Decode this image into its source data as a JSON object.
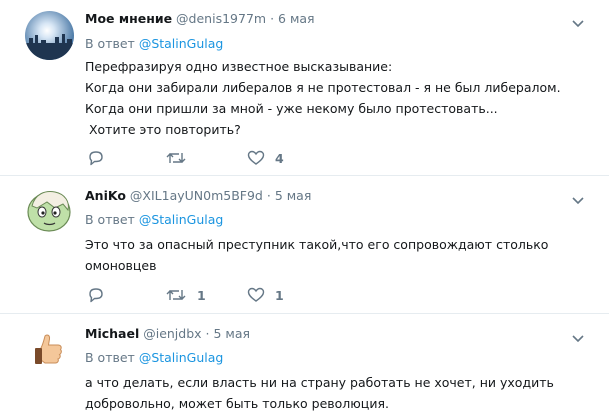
{
  "tweets": [
    {
      "name": "Мое мнение",
      "handle": "@denis1977m",
      "dot": "·",
      "date": "6 мая",
      "reply_prefix": "В ответ",
      "reply_mention": "@StalinGulag",
      "lines": [
        "Перефразируя одно известное высказывание:",
        "Когда они забирали либералов я не протестовал - я не был либералом.",
        "Когда они пришли за мной - уже некому было протестовать...",
        " Хотите это повторить?"
      ],
      "replies": "",
      "retweets": "",
      "likes": "4",
      "avatar_icon": "city-skyline-avatar"
    },
    {
      "name": "AniKo",
      "handle": "@XIL1ayUN0m5BF9d",
      "dot": "·",
      "date": "5 мая",
      "reply_prefix": "В ответ",
      "reply_mention": "@StalinGulag",
      "lines": [
        "Это что за опасный преступник такой,что его сопровождают столько",
        "омоновцев"
      ],
      "replies": "",
      "retweets": "1",
      "likes": "1",
      "avatar_icon": "cartoon-face-avatar"
    },
    {
      "name": "Michael",
      "handle": "@ienjdbx",
      "dot": "·",
      "date": "5 мая",
      "reply_prefix": "В ответ",
      "reply_mention": "@StalinGulag",
      "lines": [
        "а что делать, если власть ни на страну работать не хочет, ни уходить",
        "добровольно, может быть только революция."
      ],
      "avatar_icon": "thumbs-up-avatar"
    }
  ],
  "colors": {
    "name": "#14171a",
    "secondary": "#657786",
    "link": "#1b95e0",
    "divider": "#e6ecf0"
  }
}
